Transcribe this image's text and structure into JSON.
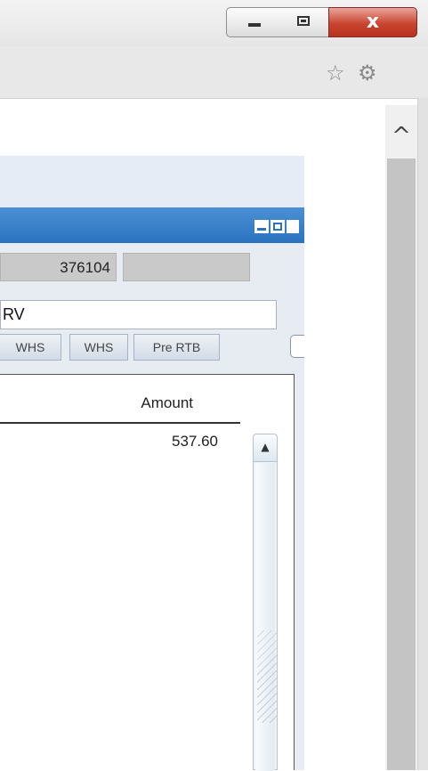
{
  "window": {
    "minimize_label": "—",
    "maximize_label": "▢",
    "close_label": "x"
  },
  "toolbar": {
    "star_icon": "☆",
    "gear_icon": "⚙"
  },
  "page_scroll": {
    "up_label": "^"
  },
  "app": {
    "fields": {
      "number_value": "376104",
      "empty_value": "",
      "text_value": "RV"
    },
    "tabs": [
      "WHS",
      "WHS",
      "Pre RTB"
    ],
    "table": {
      "columns": [
        "Amount"
      ],
      "rows": [
        [
          "537.60"
        ]
      ]
    },
    "table_scroll_up": "▲"
  },
  "colors": {
    "app_bar": "#2b73c0",
    "close_button": "#c9452f"
  }
}
